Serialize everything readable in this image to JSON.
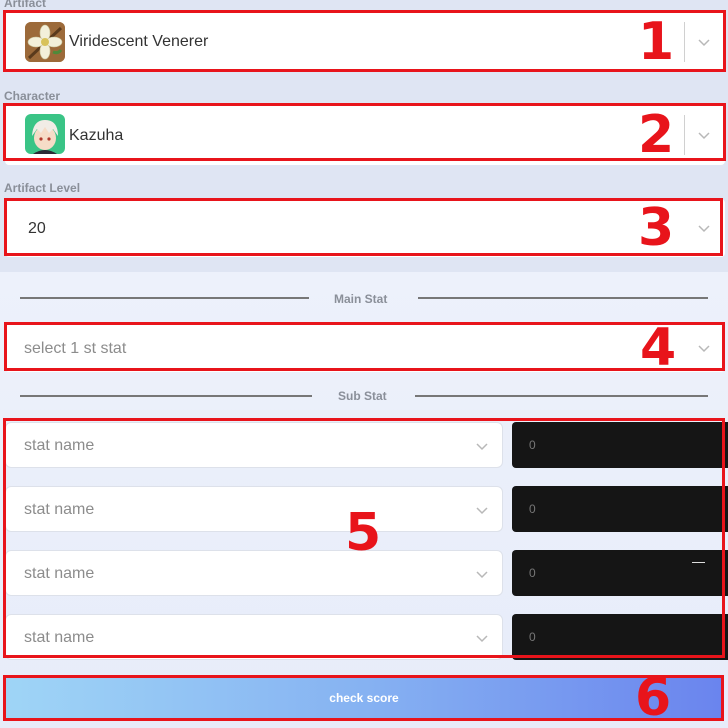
{
  "artifact": {
    "label": "Artifact",
    "value": "Viridescent Venerer",
    "icon": "flower-icon"
  },
  "character": {
    "label": "Character",
    "value": "Kazuha",
    "icon": "kazuha-avatar"
  },
  "artifact_level": {
    "label": "Artifact Level",
    "value": "20"
  },
  "main_stat": {
    "heading": "Main Stat",
    "placeholder": "select 1 st stat"
  },
  "sub_stat": {
    "heading": "Sub Stat",
    "rows": [
      {
        "name_placeholder": "stat name",
        "value": "0"
      },
      {
        "name_placeholder": "stat name",
        "value": "0"
      },
      {
        "name_placeholder": "stat name",
        "value": "0"
      },
      {
        "name_placeholder": "stat name",
        "value": "0"
      }
    ]
  },
  "check_button": {
    "label": "check score"
  },
  "annotations": {
    "n1": "1",
    "n2": "2",
    "n3": "3",
    "n4": "4",
    "n5": "5",
    "n6": "6"
  },
  "colors": {
    "annotation_red": "#e8141b",
    "button_gradient_start": "#9fd5f6",
    "button_gradient_end": "#6a84ee",
    "input_dark": "#151515"
  }
}
